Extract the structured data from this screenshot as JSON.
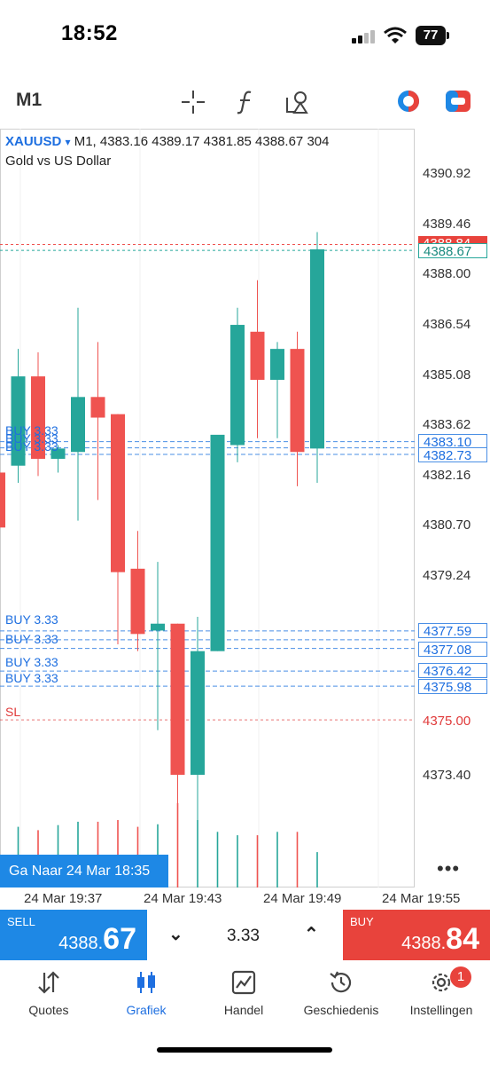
{
  "status_bar": {
    "time": "18:52",
    "battery": "77"
  },
  "toolbar": {
    "timeframe": "M1",
    "icons": [
      "crosshair-icon",
      "indicators-icon",
      "objects-icon",
      "trade-toggle-icon",
      "one-click-icon"
    ]
  },
  "chart": {
    "symbol": "XAUUSD",
    "dropdown_glyph": "▾",
    "ohlc_text": "M1, 4383.16 4389.17 4381.85 4388.67 304",
    "description": "Gold vs US Dollar",
    "price_labels": [
      "4390.92",
      "4389.46",
      "4388.00",
      "4386.54",
      "4385.08",
      "4383.62",
      "4382.16",
      "4380.70",
      "4379.24",
      "4373.40"
    ],
    "tags": {
      "ask": "4388.84",
      "bid": "4388.67",
      "order_high_1": "4383.10",
      "order_high_2": "4382.73",
      "order_low_1": "4377.59",
      "order_low_2": "4377.08",
      "order_low_3": "4376.42",
      "order_low_4": "4375.98",
      "stop_loss": "4375.00"
    },
    "order_labels": {
      "buy_label": "BUY 3.33",
      "sl_label": "SL"
    },
    "goto_button": "Ga Naar 24 Mar 18:35",
    "more_glyph": "•••",
    "time_labels": [
      "24 Mar 19:37",
      "24 Mar 19:43",
      "24 Mar 19:49",
      "24 Mar 19:55"
    ],
    "colors": {
      "bull": "#26a69a",
      "bear": "#ef5350",
      "order_line": "#4a8fe5",
      "sl_line": "#e03a3a"
    }
  },
  "chart_data": {
    "type": "candlestick",
    "symbol": "XAUUSD",
    "timeframe": "M1",
    "ylim": [
      4372.0,
      4392.5
    ],
    "x_ticks": [
      "24 Mar 19:37",
      "24 Mar 19:43",
      "24 Mar 19:49",
      "24 Mar 19:55"
    ],
    "candles": [
      {
        "o": 4382.2,
        "h": 4382.9,
        "l": 4380.4,
        "c": 4380.6
      },
      {
        "o": 4382.4,
        "h": 4385.8,
        "l": 4381.9,
        "c": 4385.0
      },
      {
        "o": 4385.0,
        "h": 4385.7,
        "l": 4382.1,
        "c": 4382.6
      },
      {
        "o": 4382.6,
        "h": 4383.0,
        "l": 4382.2,
        "c": 4382.9
      },
      {
        "o": 4382.8,
        "h": 4387.0,
        "l": 4380.8,
        "c": 4384.4
      },
      {
        "o": 4384.4,
        "h": 4386.0,
        "l": 4381.4,
        "c": 4383.8
      },
      {
        "o": 4383.9,
        "h": 4383.9,
        "l": 4377.2,
        "c": 4379.3
      },
      {
        "o": 4379.4,
        "h": 4380.5,
        "l": 4377.0,
        "c": 4377.5
      },
      {
        "o": 4377.6,
        "h": 4379.6,
        "l": 4374.7,
        "c": 4377.8
      },
      {
        "o": 4377.8,
        "h": 4377.8,
        "l": 4371.5,
        "c": 4373.4
      },
      {
        "o": 4373.4,
        "h": 4378.0,
        "l": 4372.0,
        "c": 4377.0
      },
      {
        "o": 4377.0,
        "h": 4383.2,
        "l": 4377.0,
        "c": 4383.3
      },
      {
        "o": 4383.0,
        "h": 4387.0,
        "l": 4382.5,
        "c": 4386.5
      },
      {
        "o": 4386.3,
        "h": 4387.8,
        "l": 4383.2,
        "c": 4384.9
      },
      {
        "o": 4384.9,
        "h": 4386.0,
        "l": 4383.2,
        "c": 4385.8
      },
      {
        "o": 4385.8,
        "h": 4386.3,
        "l": 4381.8,
        "c": 4382.8
      },
      {
        "o": 4382.9,
        "h": 4389.2,
        "l": 4381.9,
        "c": 4388.7
      }
    ],
    "volumes": [
      0.7,
      0.72,
      0.68,
      0.74,
      0.78,
      0.78,
      0.8,
      0.72,
      0.75,
      1.0,
      0.8,
      0.66,
      0.62,
      0.62,
      0.66,
      0.66,
      0.42
    ],
    "ask": 4388.84,
    "bid": 4388.67,
    "buy_orders": [
      4383.1,
      4382.92,
      4382.73,
      4377.59,
      4377.33,
      4377.08,
      4376.42,
      4375.98
    ],
    "order_volume": 3.33,
    "stop_loss": 4375.0
  },
  "trade_bar": {
    "sell_label": "SELL",
    "sell_price_small": "4388.",
    "sell_price_big": "67",
    "buy_label": "BUY",
    "buy_price_small": "4388.",
    "buy_price_big": "84",
    "volume": "3.33",
    "down_glyph": "⌄",
    "up_glyph": "⌃"
  },
  "nav": {
    "items": [
      {
        "label": "Quotes",
        "icon": "quotes-icon"
      },
      {
        "label": "Grafiek",
        "icon": "chart-icon"
      },
      {
        "label": "Handel",
        "icon": "trade-icon"
      },
      {
        "label": "Geschiedenis",
        "icon": "history-icon"
      },
      {
        "label": "Instellingen",
        "icon": "settings-icon"
      }
    ],
    "badge": "1"
  }
}
